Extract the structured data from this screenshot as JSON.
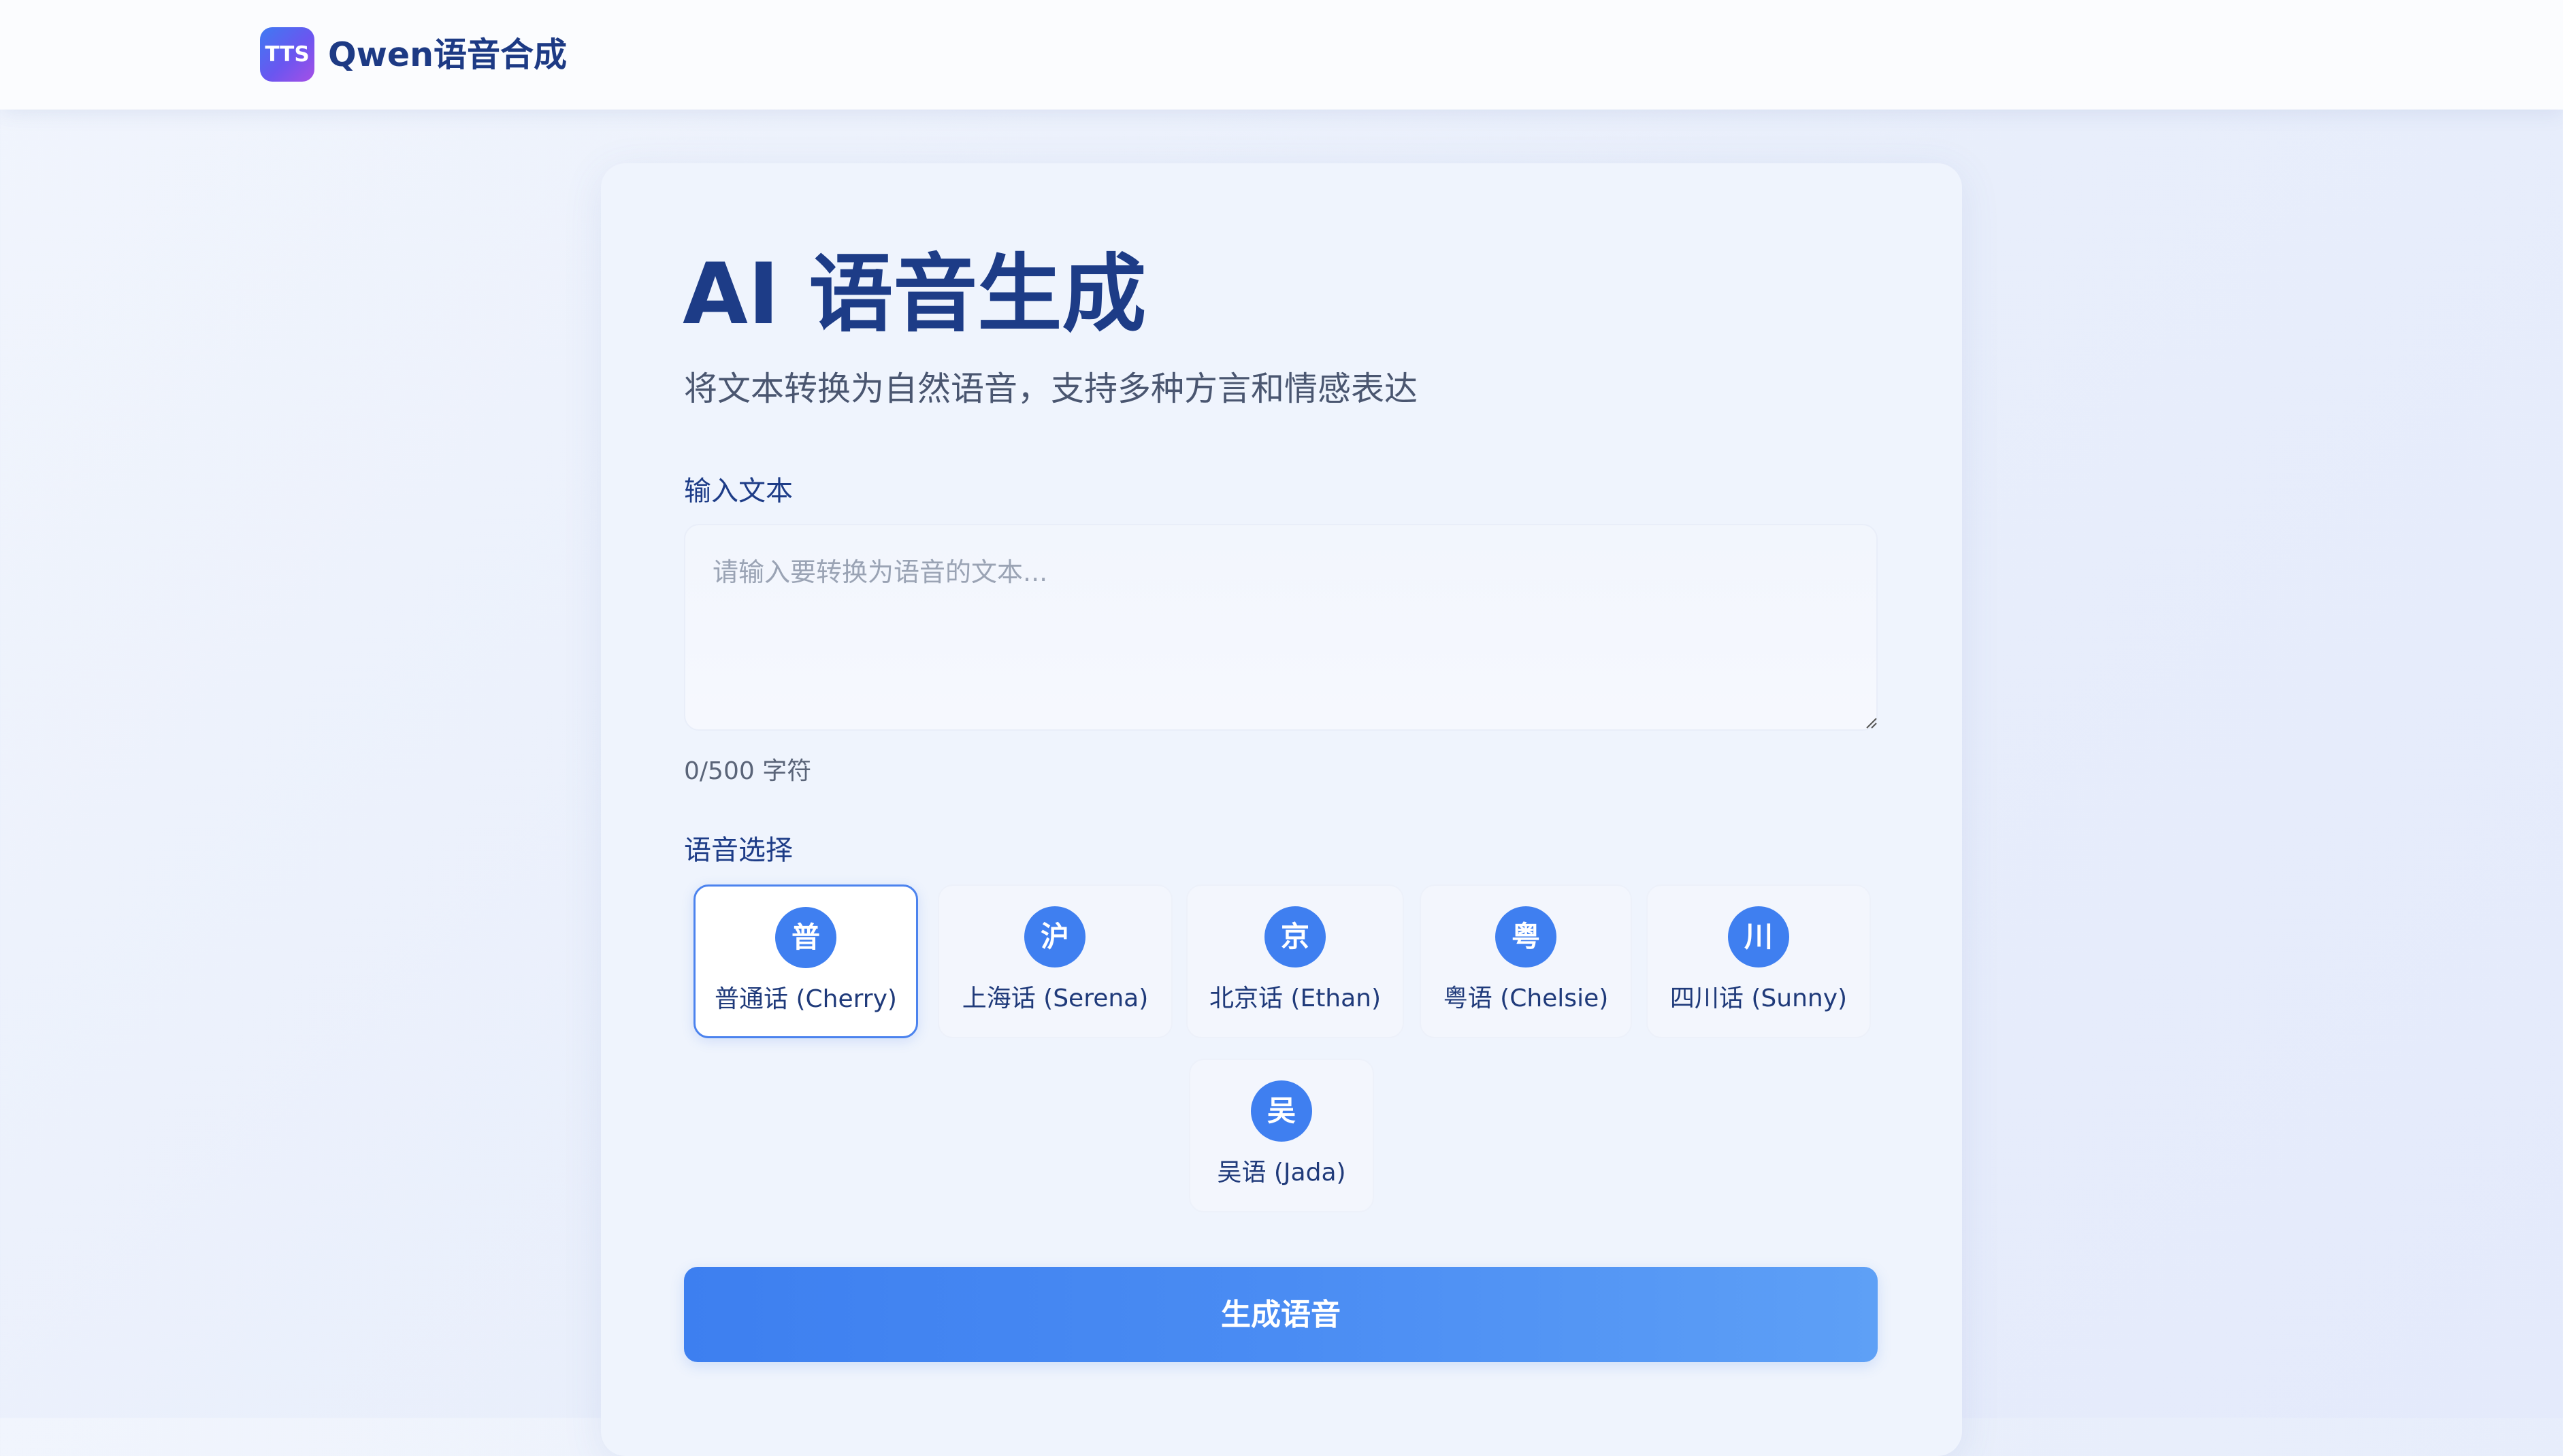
{
  "header": {
    "logo_text": "TTS",
    "brand": "Qwen语音合成"
  },
  "main": {
    "title": "AI 语音生成",
    "subtitle": "将文本转换为自然语音，支持多种方言和情感表达",
    "input_label": "输入文本",
    "input_placeholder": "请输入要转换为语音的文本...",
    "input_value": "",
    "char_count": "0/500 字符",
    "voice_label": "语音选择",
    "voices": [
      {
        "avatar": "普",
        "name": "普通话 (Cherry)",
        "selected": true
      },
      {
        "avatar": "沪",
        "name": "上海话 (Serena)",
        "selected": false
      },
      {
        "avatar": "京",
        "name": "北京话 (Ethan)",
        "selected": false
      },
      {
        "avatar": "粤",
        "name": "粤语 (Chelsie)",
        "selected": false
      },
      {
        "avatar": "川",
        "name": "四川话 (Sunny)",
        "selected": false
      },
      {
        "avatar": "吴",
        "name": "吴语 (Jada)",
        "selected": false
      }
    ],
    "generate_label": "生成语音"
  },
  "colors": {
    "accent": "#3f7ff0",
    "title": "#1d3c87",
    "card_bg": "#eff4fd"
  }
}
